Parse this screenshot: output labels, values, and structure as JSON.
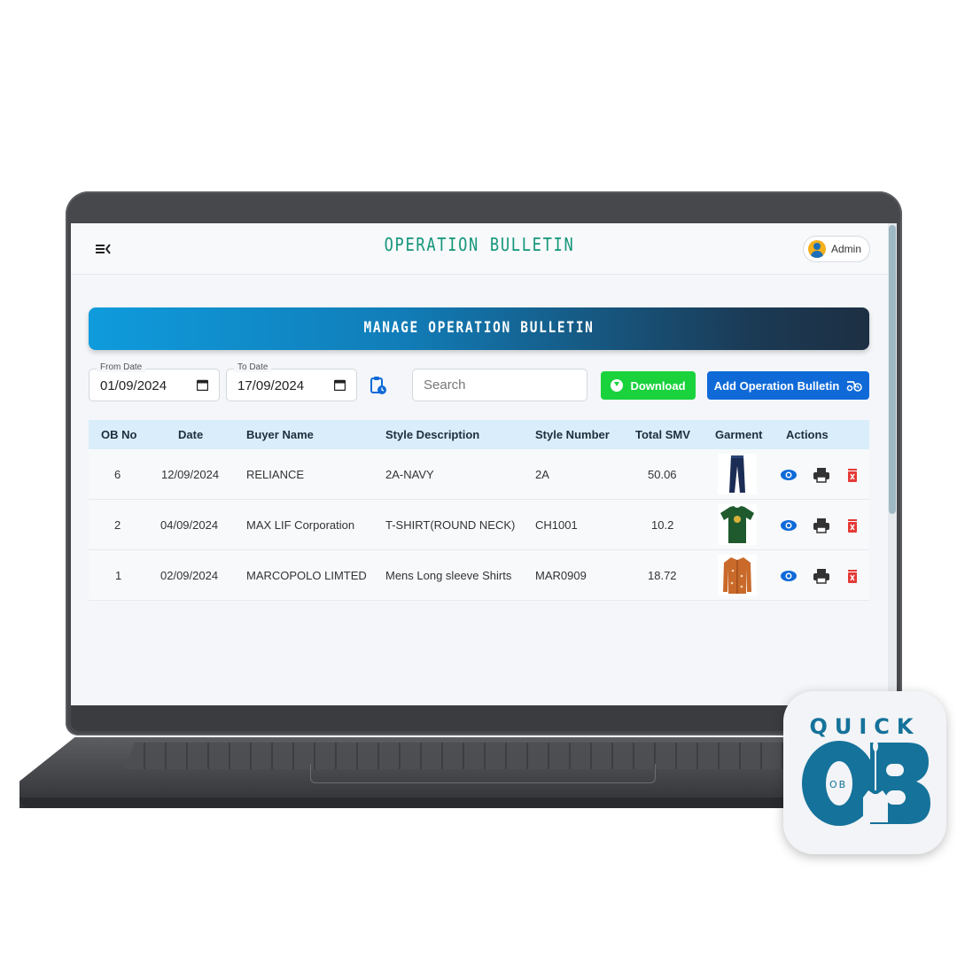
{
  "header": {
    "title": "OPERATION BULLETIN",
    "user_label": "Admin"
  },
  "banner": {
    "title": "MANAGE OPERATION BULLETIN"
  },
  "filters": {
    "from_label": "From Date",
    "from_value": "01/09/2024",
    "to_label": "To Date",
    "to_value": "17/09/2024",
    "search_placeholder": "Search",
    "download_label": "Download",
    "add_label": "Add Operation Bulletin"
  },
  "table": {
    "columns": [
      "OB No",
      "Date",
      "Buyer Name",
      "Style Description",
      "Style Number",
      "Total SMV",
      "Garment",
      "Actions"
    ],
    "rows": [
      {
        "ob_no": "6",
        "date": "12/09/2024",
        "buyer": "RELIANCE",
        "style_desc": "2A-NAVY",
        "style_no": "2A",
        "smv": "50.06",
        "garment": "jeans-icon"
      },
      {
        "ob_no": "2",
        "date": "04/09/2024",
        "buyer": "MAX LIF Corporation",
        "style_desc": "T-SHIRT(ROUND NECK)",
        "style_no": "CH1001",
        "smv": "10.2",
        "garment": "tshirt-icon"
      },
      {
        "ob_no": "1",
        "date": "02/09/2024",
        "buyer": "MARCOPOLO LIMTED",
        "style_desc": "Mens Long sleeve Shirts",
        "style_no": "MAR0909",
        "smv": "18.72",
        "garment": "shirt-icon"
      }
    ]
  },
  "badge": {
    "top_text": "QUICK",
    "small_text": "OB"
  },
  "colors": {
    "title_green": "#14967a",
    "download_green": "#19d23c",
    "primary_blue": "#0f6ad8",
    "delete_red": "#e53935",
    "badge_blue": "#15729a"
  }
}
